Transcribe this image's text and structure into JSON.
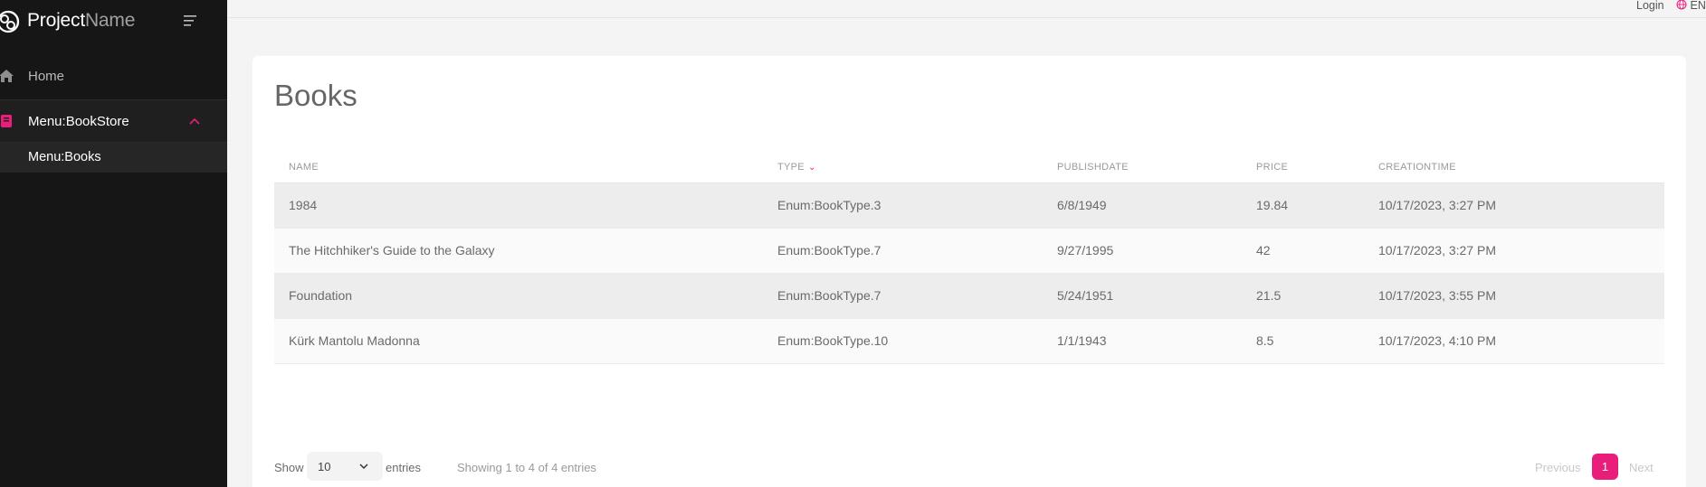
{
  "brand": {
    "title_bold": "Project",
    "title_light": "Name"
  },
  "sidebar": {
    "items": [
      {
        "label": "Home",
        "icon": "home-icon"
      },
      {
        "label": "Menu:BookStore",
        "icon": "book-icon"
      },
      {
        "label": "Menu:Books"
      }
    ]
  },
  "topbar": {
    "login": "Login",
    "lang": "EN"
  },
  "main": {
    "title": "Books",
    "columns": [
      "NAME",
      "TYPE",
      "PUBLISHDATE",
      "PRICE",
      "CREATIONTIME"
    ],
    "rows": [
      [
        "1984",
        "Enum:BookType.3",
        "6/8/1949",
        "19.84",
        "10/17/2023, 3:27 PM"
      ],
      [
        "The Hitchhiker's Guide to the Galaxy",
        "Enum:BookType.7",
        "9/27/1995",
        "42",
        "10/17/2023, 3:27 PM"
      ],
      [
        "Foundation",
        "Enum:BookType.7",
        "5/24/1951",
        "21.5",
        "10/17/2023, 3:55 PM"
      ],
      [
        "Kürk Mantolu Madonna",
        "Enum:BookType.10",
        "1/1/1943",
        "8.5",
        "10/17/2023, 4:10 PM"
      ]
    ]
  },
  "footer": {
    "show": "Show",
    "page_size": "10",
    "entries": "entries",
    "info": "Showing 1 to 4 of 4 entries",
    "previous": "Previous",
    "current_page": "1",
    "next": "Next"
  },
  "colors": {
    "accent": "#e91e7a",
    "sidebar_bg": "#161616"
  }
}
